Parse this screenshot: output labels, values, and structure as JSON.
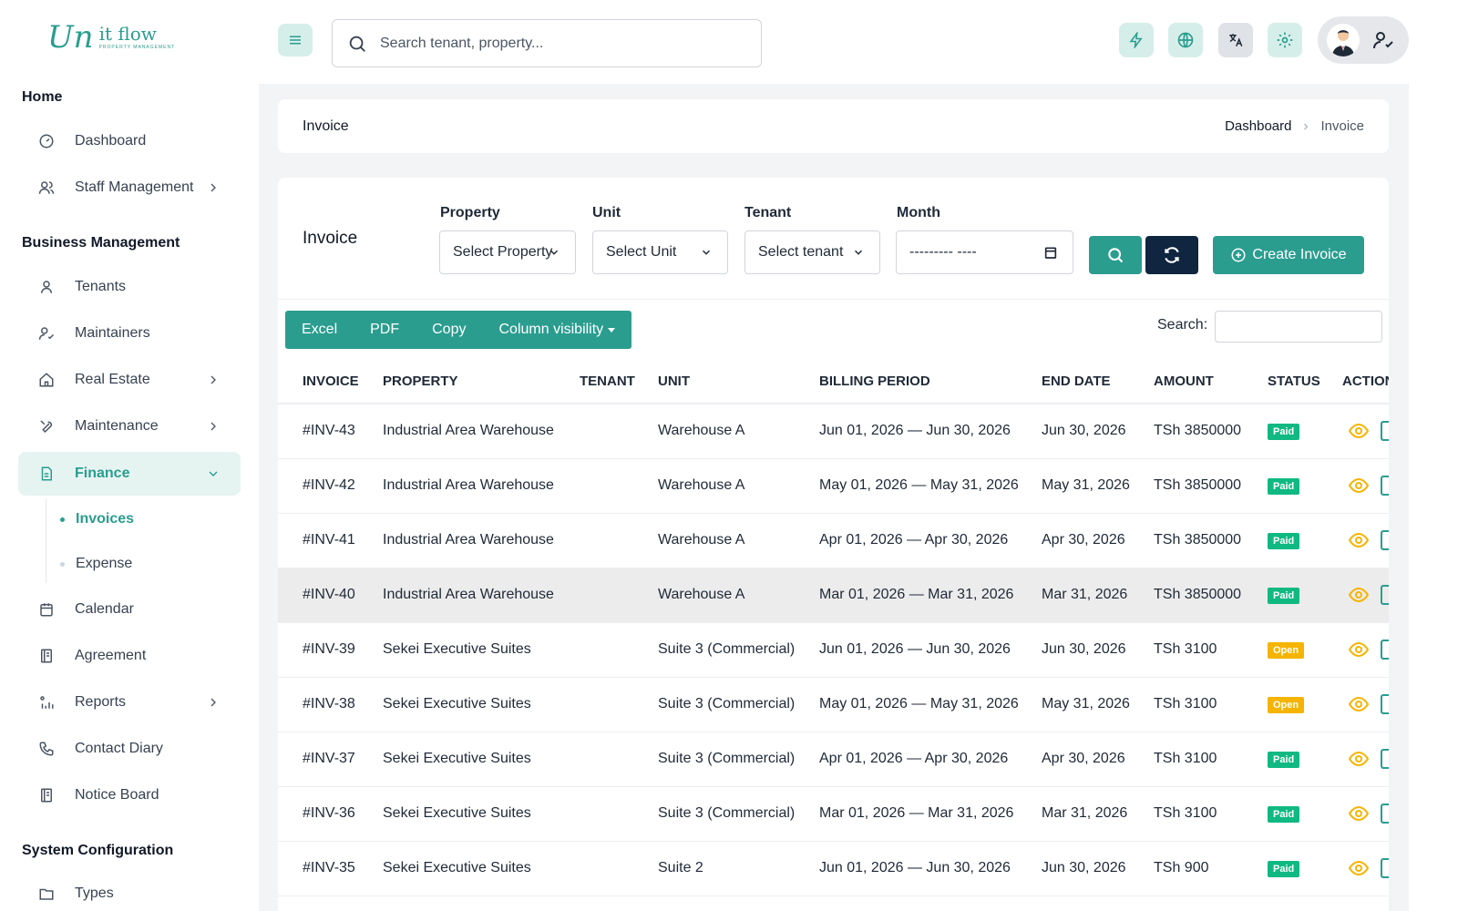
{
  "brand": {
    "logo_mark": "Un",
    "logo_word": "it flow",
    "logo_sub": "PROPERTY MANAGEMENT"
  },
  "sidebar": {
    "sections": [
      {
        "title": "Home"
      },
      {
        "title": "Business Management"
      },
      {
        "title": "System Configuration"
      }
    ],
    "items": [
      {
        "label": "Dashboard",
        "icon": "dashboard-icon"
      },
      {
        "label": "Staff Management",
        "icon": "users-icon"
      },
      {
        "label": "Tenants",
        "icon": "user-icon"
      },
      {
        "label": "Maintainers",
        "icon": "user-check-icon"
      },
      {
        "label": "Real Estate",
        "icon": "home-icon"
      },
      {
        "label": "Maintenance",
        "icon": "tool-icon"
      },
      {
        "label": "Finance",
        "icon": "document-icon"
      },
      {
        "label": "Calendar",
        "icon": "calendar-icon"
      },
      {
        "label": "Agreement",
        "icon": "book-icon"
      },
      {
        "label": "Reports",
        "icon": "chart-icon"
      },
      {
        "label": "Contact Diary",
        "icon": "phone-icon"
      },
      {
        "label": "Notice Board",
        "icon": "notice-icon"
      },
      {
        "label": "Types",
        "icon": "folder-icon"
      }
    ],
    "finance_sub": [
      {
        "label": "Invoices"
      },
      {
        "label": "Expense"
      }
    ]
  },
  "topbar": {
    "search_placeholder": "Search tenant, property...",
    "icons": [
      "lightning-icon",
      "globe-icon",
      "translate-icon",
      "gear-icon"
    ]
  },
  "page": {
    "title": "Invoice",
    "breadcrumb": {
      "home": "Dashboard",
      "current": "Invoice"
    }
  },
  "filters": {
    "card_title": "Invoice",
    "property": {
      "label": "Property",
      "value": "Select Property"
    },
    "unit": {
      "label": "Unit",
      "value": "Select Unit"
    },
    "tenant": {
      "label": "Tenant",
      "value": "Select tenant"
    },
    "month": {
      "label": "Month",
      "value": "--------- ----"
    },
    "create_label": "Create Invoice"
  },
  "toolbar": {
    "excel": "Excel",
    "pdf": "PDF",
    "copy": "Copy",
    "column_visibility": "Column visibility",
    "search_label": "Search:"
  },
  "colors": {
    "accent": "#2a9d8f",
    "dark": "#0f2540",
    "paid": "#10b981",
    "open": "#f5b400"
  },
  "table": {
    "headers": [
      "INVOICE",
      "PROPERTY",
      "TENANT",
      "UNIT",
      "BILLING PERIOD",
      "END DATE",
      "AMOUNT",
      "STATUS",
      "ACTION"
    ],
    "rows": [
      {
        "invoice": "#INV-43",
        "property": "Industrial Area Warehouse",
        "tenant": "",
        "unit": "Warehouse A",
        "period": "Jun 01, 2026 — Jun 30, 2026",
        "end": "Jun 30, 2026",
        "amount": "TSh 3850000",
        "status": "Paid"
      },
      {
        "invoice": "#INV-42",
        "property": "Industrial Area Warehouse",
        "tenant": "",
        "unit": "Warehouse A",
        "period": "May 01, 2026 — May 31, 2026",
        "end": "May 31, 2026",
        "amount": "TSh 3850000",
        "status": "Paid"
      },
      {
        "invoice": "#INV-41",
        "property": "Industrial Area Warehouse",
        "tenant": "",
        "unit": "Warehouse A",
        "period": "Apr 01, 2026 — Apr 30, 2026",
        "end": "Apr 30, 2026",
        "amount": "TSh 3850000",
        "status": "Paid"
      },
      {
        "invoice": "#INV-40",
        "property": "Industrial Area Warehouse",
        "tenant": "",
        "unit": "Warehouse A",
        "period": "Mar 01, 2026 — Mar 31, 2026",
        "end": "Mar 31, 2026",
        "amount": "TSh 3850000",
        "status": "Paid"
      },
      {
        "invoice": "#INV-39",
        "property": "Sekei Executive Suites",
        "tenant": "",
        "unit": "Suite 3 (Commercial)",
        "period": "Jun 01, 2026 — Jun 30, 2026",
        "end": "Jun 30, 2026",
        "amount": "TSh 3100",
        "status": "Open"
      },
      {
        "invoice": "#INV-38",
        "property": "Sekei Executive Suites",
        "tenant": "",
        "unit": "Suite 3 (Commercial)",
        "period": "May 01, 2026 — May 31, 2026",
        "end": "May 31, 2026",
        "amount": "TSh 3100",
        "status": "Open"
      },
      {
        "invoice": "#INV-37",
        "property": "Sekei Executive Suites",
        "tenant": "",
        "unit": "Suite 3 (Commercial)",
        "period": "Apr 01, 2026 — Apr 30, 2026",
        "end": "Apr 30, 2026",
        "amount": "TSh 3100",
        "status": "Paid"
      },
      {
        "invoice": "#INV-36",
        "property": "Sekei Executive Suites",
        "tenant": "",
        "unit": "Suite 3 (Commercial)",
        "period": "Mar 01, 2026 — Mar 31, 2026",
        "end": "Mar 31, 2026",
        "amount": "TSh 3100",
        "status": "Paid"
      },
      {
        "invoice": "#INV-35",
        "property": "Sekei Executive Suites",
        "tenant": "",
        "unit": "Suite 2",
        "period": "Jun 01, 2026 — Jun 30, 2026",
        "end": "Jun 30, 2026",
        "amount": "TSh 900",
        "status": "Paid"
      }
    ]
  }
}
